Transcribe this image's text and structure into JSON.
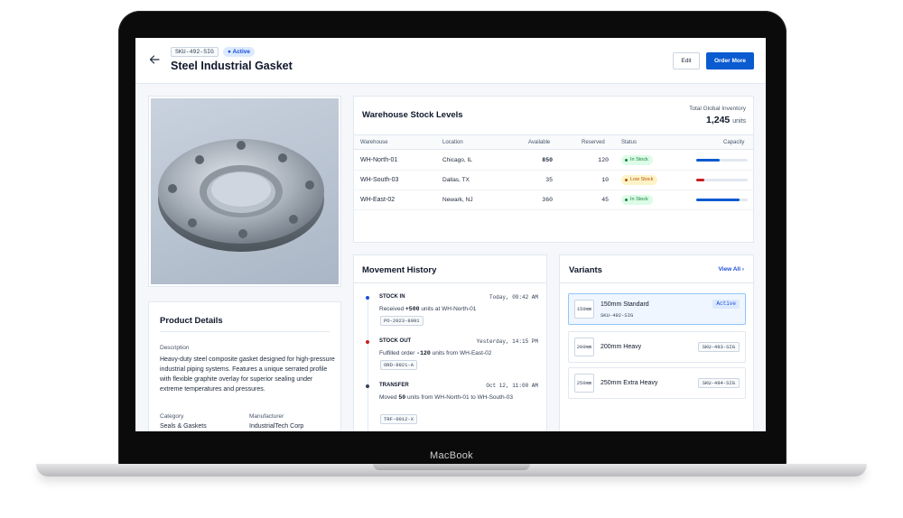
{
  "device": {
    "brand": "MacBook"
  },
  "header": {
    "sku": "SKU-492-SIG",
    "status": "Active",
    "title": "Steel Industrial Gasket",
    "edit_label": "Edit",
    "order_label": "Order More"
  },
  "product_details": {
    "title": "Product Details",
    "description_label": "Description",
    "description": "Heavy-duty steel composite gasket designed for high-pressure industrial piping systems. Features a unique serrated profile with flexible graphite overlay for superior sealing under extreme temperatures and pressures.",
    "category_label": "Category",
    "category": "Seals & Gaskets",
    "manufacturer_label": "Manufacturer",
    "manufacturer": "IndustrialTech Corp"
  },
  "stock": {
    "title": "Warehouse Stock Levels",
    "total_label": "Total Global Inventory",
    "total_value": "1,245",
    "total_unit": "units",
    "columns": [
      "Warehouse",
      "Location",
      "Available",
      "Reserved",
      "Status",
      "Capacity"
    ],
    "rows": [
      {
        "warehouse": "WH-North-01",
        "location": "Chicago, IL",
        "available": "850",
        "reserved": "120",
        "status": "In Stock",
        "capacity_pct": 45,
        "bar_color": "#0a5ad0"
      },
      {
        "warehouse": "WH-South-03",
        "location": "Dallas, TX",
        "available": "35",
        "reserved": "10",
        "status": "Low Stock",
        "capacity_pct": 15,
        "bar_color": "#c81e1e"
      },
      {
        "warehouse": "WH-East-02",
        "location": "Newark, NJ",
        "available": "360",
        "reserved": "45",
        "status": "In Stock",
        "capacity_pct": 85,
        "bar_color": "#0a5ad0"
      }
    ]
  },
  "movement": {
    "title": "Movement History",
    "events": [
      {
        "type": "STOCK IN",
        "time": "Today, 09:42 AM",
        "pre": "Received ",
        "qty": "+500",
        "post": " units at WH-North-01",
        "ref": "PO-2023-8991",
        "color": "#1d4ed8"
      },
      {
        "type": "STOCK OUT",
        "time": "Yesterday, 14:15 PM",
        "pre": "Fulfilled order ",
        "qty": "-120",
        "post": " units from WH-East-02",
        "ref": "ORD-9921-A",
        "color": "#c81e1e"
      },
      {
        "type": "TRANSFER",
        "time": "Oct 12, 11:00 AM",
        "pre": "Moved ",
        "qty": "50",
        "post": " units from WH-North-01 to WH-South-03",
        "ref": "TRF-0012-X",
        "color": "#334155"
      }
    ]
  },
  "variants": {
    "title": "Variants",
    "view_all": "View All",
    "items": [
      {
        "thumb": "150mm",
        "name": "150mm Standard",
        "sku": "SKU-492-SIG",
        "badge": "Active"
      },
      {
        "thumb": "200mm",
        "name": "200mm Heavy",
        "sku": "SKU-493-SIG"
      },
      {
        "thumb": "250mm",
        "name": "250mm Extra Heavy",
        "sku": "SKU-494-SIG"
      }
    ]
  },
  "colors": {
    "accent": "#0a5ad0",
    "danger": "#c81e1e",
    "success": "#15803d",
    "warning": "#b45309"
  }
}
